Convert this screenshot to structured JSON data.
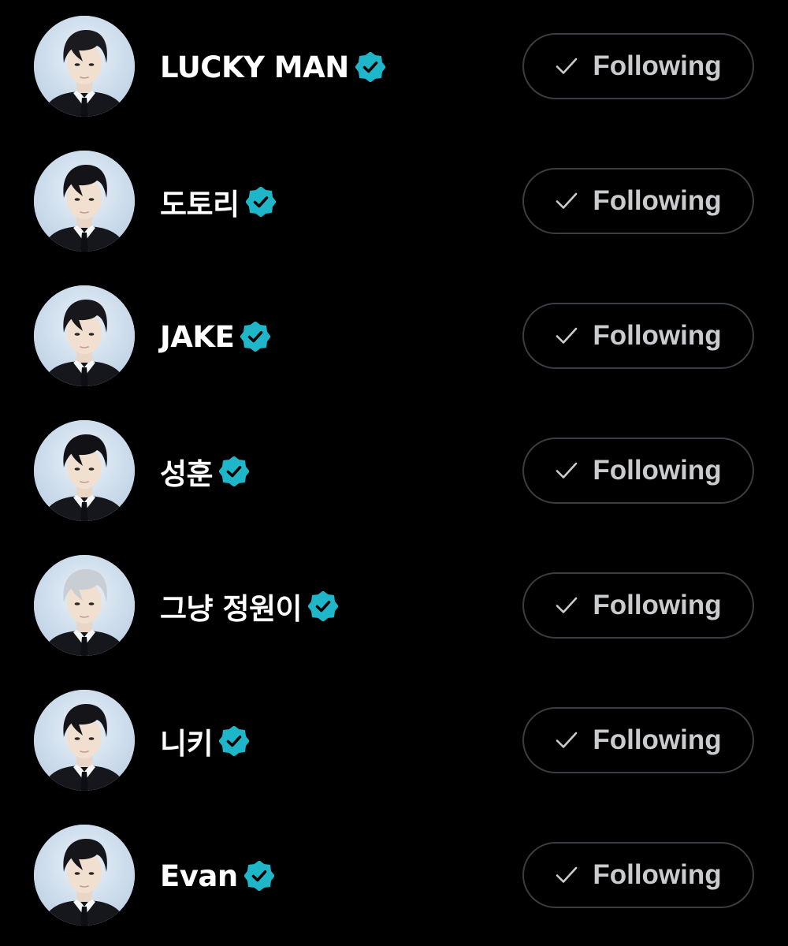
{
  "colors": {
    "background": "#000000",
    "verified_badge": "#1fb6c9",
    "button_border": "#3a3d42",
    "button_text": "#c9cbcf",
    "name_text": "#ffffff"
  },
  "follow_button": {
    "icon": "checkmark-icon",
    "label": "Following"
  },
  "users": [
    {
      "name": "LUCKY MAN",
      "verified": true,
      "hair": "#1a1a1f",
      "button_label": "Following"
    },
    {
      "name": "도토리",
      "verified": true,
      "hair": "#141418",
      "button_label": "Following"
    },
    {
      "name": "JAKE",
      "verified": true,
      "hair": "#17171c",
      "button_label": "Following"
    },
    {
      "name": "성훈",
      "verified": true,
      "hair": "#121216",
      "button_label": "Following"
    },
    {
      "name": "그냥 정원이",
      "verified": true,
      "hair": "#c9cdd4",
      "button_label": "Following"
    },
    {
      "name": "니키",
      "verified": true,
      "hair": "#141419",
      "button_label": "Following"
    },
    {
      "name": "Evan",
      "verified": true,
      "hair": "#15151a",
      "button_label": "Following"
    }
  ]
}
